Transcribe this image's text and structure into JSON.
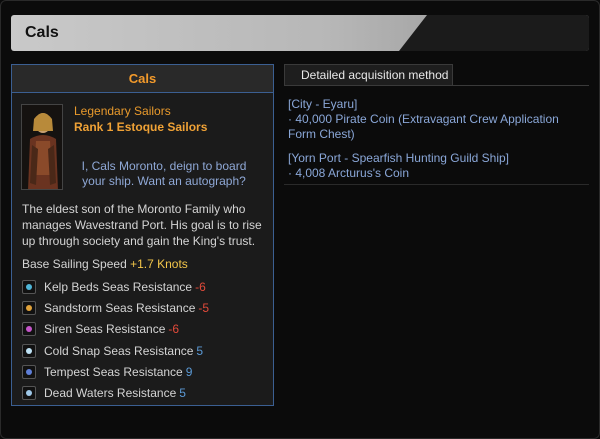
{
  "window": {
    "title": "Cals"
  },
  "card": {
    "header": "Cals",
    "sailor_type": "Legendary Sailors",
    "sailor_rank": "Rank 1 Estoque Sailors",
    "quote": "I, Cals Moronto, deign to board your ship. Want an autograph?",
    "bio": "The eldest son of the Moronto Family who manages Wavestrand Port. His goal is to rise up through society and gain the King's trust.",
    "speed_label": "Base Sailing Speed",
    "speed_value": "+1.7 Knots",
    "resistances": [
      {
        "label": "Kelp Beds Seas Resistance",
        "value": "-6",
        "icon": "kelp-beds-icon",
        "color": "#4fb6d8"
      },
      {
        "label": "Sandstorm Seas Resistance",
        "value": "-5",
        "icon": "sandstorm-icon",
        "color": "#e0a23a"
      },
      {
        "label": "Siren Seas Resistance",
        "value": "-6",
        "icon": "siren-icon",
        "color": "#c455c8"
      },
      {
        "label": "Cold Snap Seas Resistance",
        "value": "5",
        "icon": "cold-snap-icon",
        "color": "#bfe3f5"
      },
      {
        "label": "Tempest Seas Resistance",
        "value": "9",
        "icon": "tempest-icon",
        "color": "#5f7fd8"
      },
      {
        "label": "Dead Waters Resistance",
        "value": "5",
        "icon": "dead-waters-icon",
        "color": "#9fc8e8"
      }
    ]
  },
  "acquisition": {
    "tab_label": "Detailed acquisition method",
    "entries": [
      {
        "location": "[City - Eyaru]",
        "cost": "· 40,000 Pirate Coin (Extravagant Crew Application Form Chest)"
      },
      {
        "location": "[Yorn Port - Spearfish Hunting Guild Ship]",
        "cost": "· 4,008 Arcturus's Coin"
      }
    ]
  }
}
